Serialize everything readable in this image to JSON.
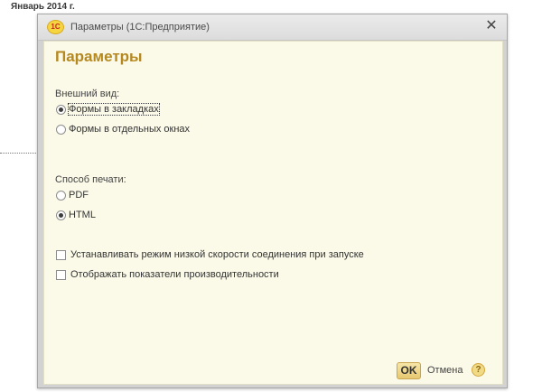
{
  "background": {
    "header": "Январь 2014 г."
  },
  "dialog": {
    "logo_text": "1С",
    "title": "Параметры (1С:Предприятие)",
    "close_glyph": "✕",
    "form_title": "Параметры"
  },
  "appearance": {
    "label": "Внешний вид:",
    "options": [
      {
        "label": "Формы в закладках",
        "selected": true
      },
      {
        "label": "Формы в отдельных окнах",
        "selected": false
      }
    ]
  },
  "print": {
    "label": "Способ печати:",
    "options": [
      {
        "label": "PDF",
        "selected": false
      },
      {
        "label": "HTML",
        "selected": true
      }
    ]
  },
  "checkboxes": [
    {
      "label": "Устанавливать режим низкой скорости соединения при запуске",
      "checked": false
    },
    {
      "label": "Отображать показатели производительности",
      "checked": false
    }
  ],
  "footer": {
    "ok_label": "OK",
    "cancel_label": "Отмена",
    "help_glyph": "?"
  },
  "colors": {
    "form_title": "#b5891f",
    "content_bg": "#fbf9e8",
    "ok_button": "#e7c86f"
  }
}
